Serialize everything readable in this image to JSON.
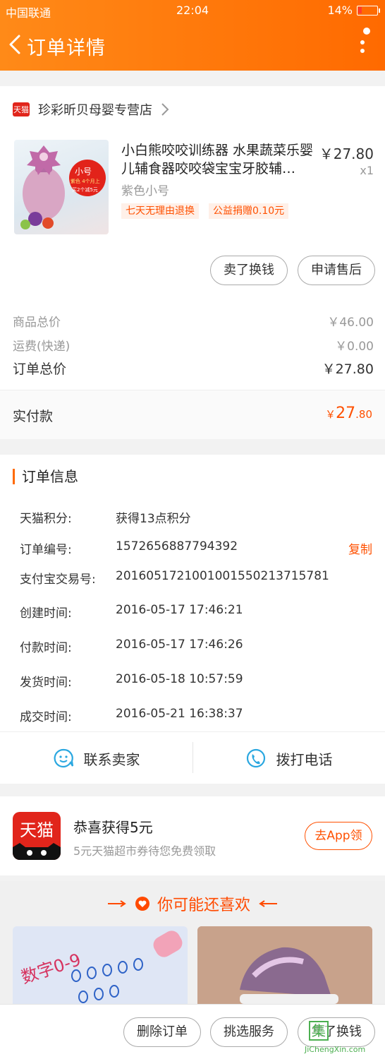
{
  "status_bar": {
    "carrier": "中国联通",
    "time": "22:04",
    "battery": "14%"
  },
  "header": {
    "title": "订单详情"
  },
  "store": {
    "name": "珍彩昕贝母婴专营店",
    "logo_text": "天猫"
  },
  "product": {
    "title": "小白熊咬咬训练器 水果蔬菜乐婴儿辅食器咬咬袋宝宝牙胶辅…",
    "price": "￥27.80",
    "qty": "x1",
    "sku": "紫色小号",
    "tags": [
      "七天无理由退换",
      "公益捐赠0.10元"
    ],
    "thumb_badge": {
      "size": "小号",
      "line1": "紫色  4个月上",
      "line2": "买2个减5元"
    }
  },
  "product_actions": {
    "sell": "卖了换钱",
    "after_sale": "申请售后"
  },
  "summary": {
    "goods_label": "商品总价",
    "goods_value": "￥46.00",
    "shipping_label": "运费(快递)",
    "shipping_value": "￥0.00",
    "total_label": "订单总价",
    "total_value": "￥27.80",
    "paid_label": "实付款",
    "paid_currency": "￥",
    "paid_int": "27",
    "paid_dec": ".80"
  },
  "order_info": {
    "title": "订单信息",
    "rows": [
      {
        "label": "天猫积分:",
        "value": "获得13点积分"
      },
      {
        "label": "订单编号:",
        "value": "1572656887794392",
        "action": "复制"
      },
      {
        "label": "支付宝交易号:",
        "value": "2016051721001001550213715781"
      },
      {
        "label": "创建时间:",
        "value": "2016-05-17 17:46:21"
      },
      {
        "label": "付款时间:",
        "value": "2016-05-17 17:46:26"
      },
      {
        "label": "发货时间:",
        "value": "2016-05-18 10:57:59"
      },
      {
        "label": "成交时间:",
        "value": "2016-05-21 16:38:37"
      }
    ],
    "contact_seller": "联系卖家",
    "call": "拨打电话"
  },
  "promo": {
    "logo_text": "天猫",
    "title": "恭喜获得5元",
    "subtitle": "5元天猫超市券待您免费领取",
    "button": "去App领"
  },
  "recommend": {
    "title": "你可能还喜欢",
    "item1_text": "数字0-9"
  },
  "bottom_bar": {
    "delete": "删除订单",
    "service": "挑选服务",
    "sell": "卖了换钱"
  },
  "watermark": {
    "text": "JiChengXin.com",
    "glyph": "集"
  },
  "colors": {
    "accent": "#ff6a00",
    "price": "#ff5000",
    "tmall_red": "#e1251b"
  }
}
